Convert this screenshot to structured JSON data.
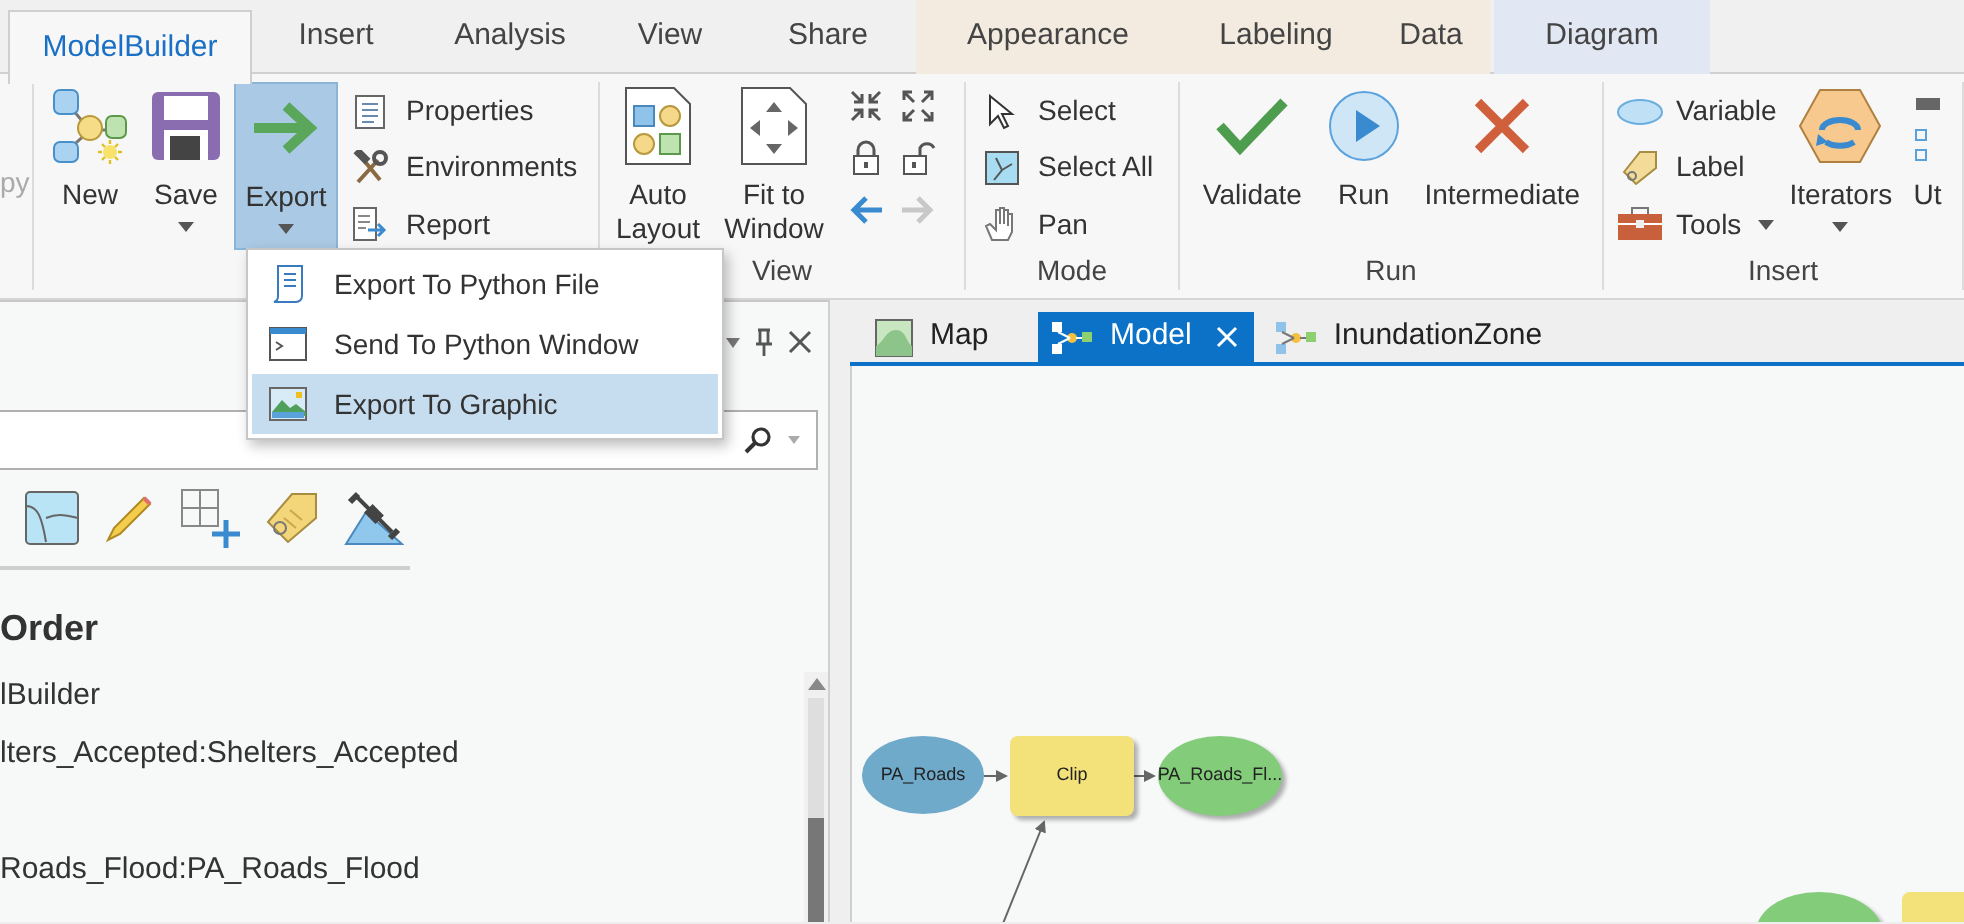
{
  "ribbon_tabs": [
    {
      "label": "ModelBuilder",
      "selected": true,
      "kind": "core"
    },
    {
      "label": "Insert",
      "selected": false,
      "kind": "core"
    },
    {
      "label": "Analysis",
      "selected": false,
      "kind": "core"
    },
    {
      "label": "View",
      "selected": false,
      "kind": "core"
    },
    {
      "label": "Share",
      "selected": false,
      "kind": "core"
    },
    {
      "label": "Appearance",
      "selected": false,
      "kind": "layer_context"
    },
    {
      "label": "Labeling",
      "selected": false,
      "kind": "layer_context"
    },
    {
      "label": "Data",
      "selected": false,
      "kind": "layer_context"
    },
    {
      "label": "Diagram",
      "selected": false,
      "kind": "diagram_context"
    }
  ],
  "ribbon": {
    "clipped_label": "py",
    "groups": [
      {
        "items": [
          {
            "kind": "large",
            "label": "New",
            "dropdown": false,
            "selected": false
          },
          {
            "kind": "large",
            "label": "Save",
            "dropdown": true,
            "selected": false
          },
          {
            "kind": "large",
            "label": "Export",
            "dropdown": true,
            "selected": true
          },
          {
            "kind": "stack",
            "entries": [
              {
                "label": "Properties",
                "dropdown": false
              },
              {
                "label": "Environments",
                "dropdown": false
              },
              {
                "label": "Report",
                "dropdown": false
              }
            ]
          }
        ]
      },
      {
        "label": "View",
        "items": [
          {
            "kind": "large",
            "label": "Auto Layout",
            "dropdown": false,
            "selected": false
          },
          {
            "kind": "large",
            "label": "Fit to Window",
            "dropdown": false,
            "selected": false
          },
          {
            "kind": "icon_grid",
            "buttons": [
              {
                "disabled": false
              },
              {
                "disabled": false
              },
              {
                "disabled": false
              },
              {
                "disabled": false
              },
              {
                "disabled": false
              },
              {
                "disabled": true
              }
            ]
          }
        ]
      },
      {
        "label": "Mode",
        "items": [
          {
            "kind": "stack",
            "entries": [
              {
                "label": "Select",
                "dropdown": false
              },
              {
                "label": "Select All",
                "dropdown": false
              },
              {
                "label": "Pan",
                "dropdown": false
              }
            ]
          }
        ]
      },
      {
        "label": "Run",
        "items": [
          {
            "kind": "large",
            "label": "Validate",
            "dropdown": false,
            "selected": false
          },
          {
            "kind": "large",
            "label": "Run",
            "dropdown": false,
            "selected": false
          },
          {
            "kind": "large",
            "label": "Intermediate",
            "dropdown": false,
            "selected": false
          }
        ]
      },
      {
        "label": "Insert",
        "items": [
          {
            "kind": "stack",
            "entries": [
              {
                "label": "Variable",
                "dropdown": false
              },
              {
                "label": "Label",
                "dropdown": false
              },
              {
                "label": "Tools",
                "dropdown": true
              }
            ]
          },
          {
            "kind": "large",
            "label": "Iterators",
            "dropdown": true,
            "selected": false
          },
          {
            "kind": "large",
            "label": "Ut",
            "dropdown": false,
            "selected": false
          }
        ]
      }
    ]
  },
  "export_menu": {
    "items": [
      {
        "label": "Export To Python File",
        "selected": false
      },
      {
        "label": "Send To Python Window",
        "selected": false
      },
      {
        "label": "Export To Graphic",
        "selected": true
      }
    ]
  },
  "contents_pane": {
    "heading": "Order",
    "lines": [
      "lBuilder",
      "lters_Accepted:Shelters_Accepted",
      "Roads_Flood:PA_Roads_Flood"
    ]
  },
  "view_tabs": [
    {
      "label": "Map",
      "selected": false
    },
    {
      "label": "Model",
      "selected": true
    },
    {
      "label": "InundationZone",
      "selected": false
    }
  ],
  "diagram": {
    "nodes": [
      {
        "kind": "input_data",
        "label": "PA_Roads"
      },
      {
        "kind": "tool",
        "label": "Clip"
      },
      {
        "kind": "derived_data",
        "label": "PA_Roads_Fl..."
      },
      {
        "kind": "derived_data"
      },
      {
        "kind": "tool"
      }
    ]
  }
}
